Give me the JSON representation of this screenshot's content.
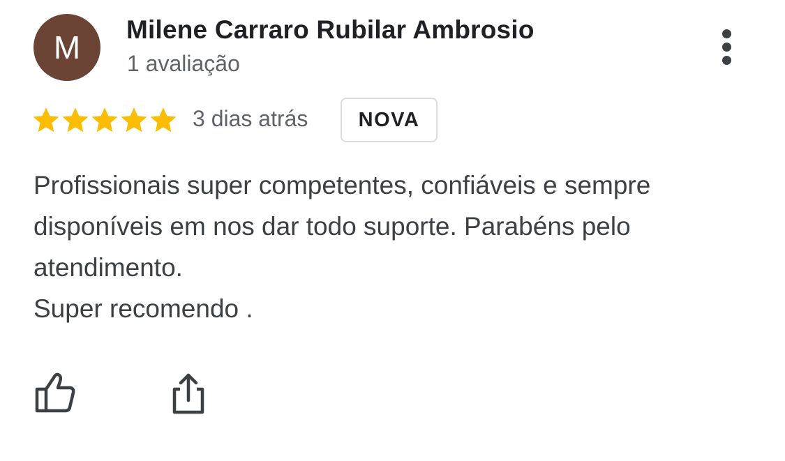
{
  "reviewer": {
    "initial": "M",
    "avatar_color": "#6b4436",
    "name": "Milene Carraro Rubilar Ambrosio",
    "review_count": "1 avaliação"
  },
  "review": {
    "rating": 5,
    "max_rating": 5,
    "star_color": "#fbbc04",
    "date": "3 dias atrás",
    "badge": "NOVA",
    "text_lines": [
      "Profissionais super competentes, confiáveis e sempre disponíveis em nos dar todo suporte. Parabéns pelo atendimento.",
      "Super recomendo ."
    ]
  },
  "icons": {
    "more": "more-vert-icon",
    "like": "thumb-up-icon",
    "share": "share-icon"
  }
}
